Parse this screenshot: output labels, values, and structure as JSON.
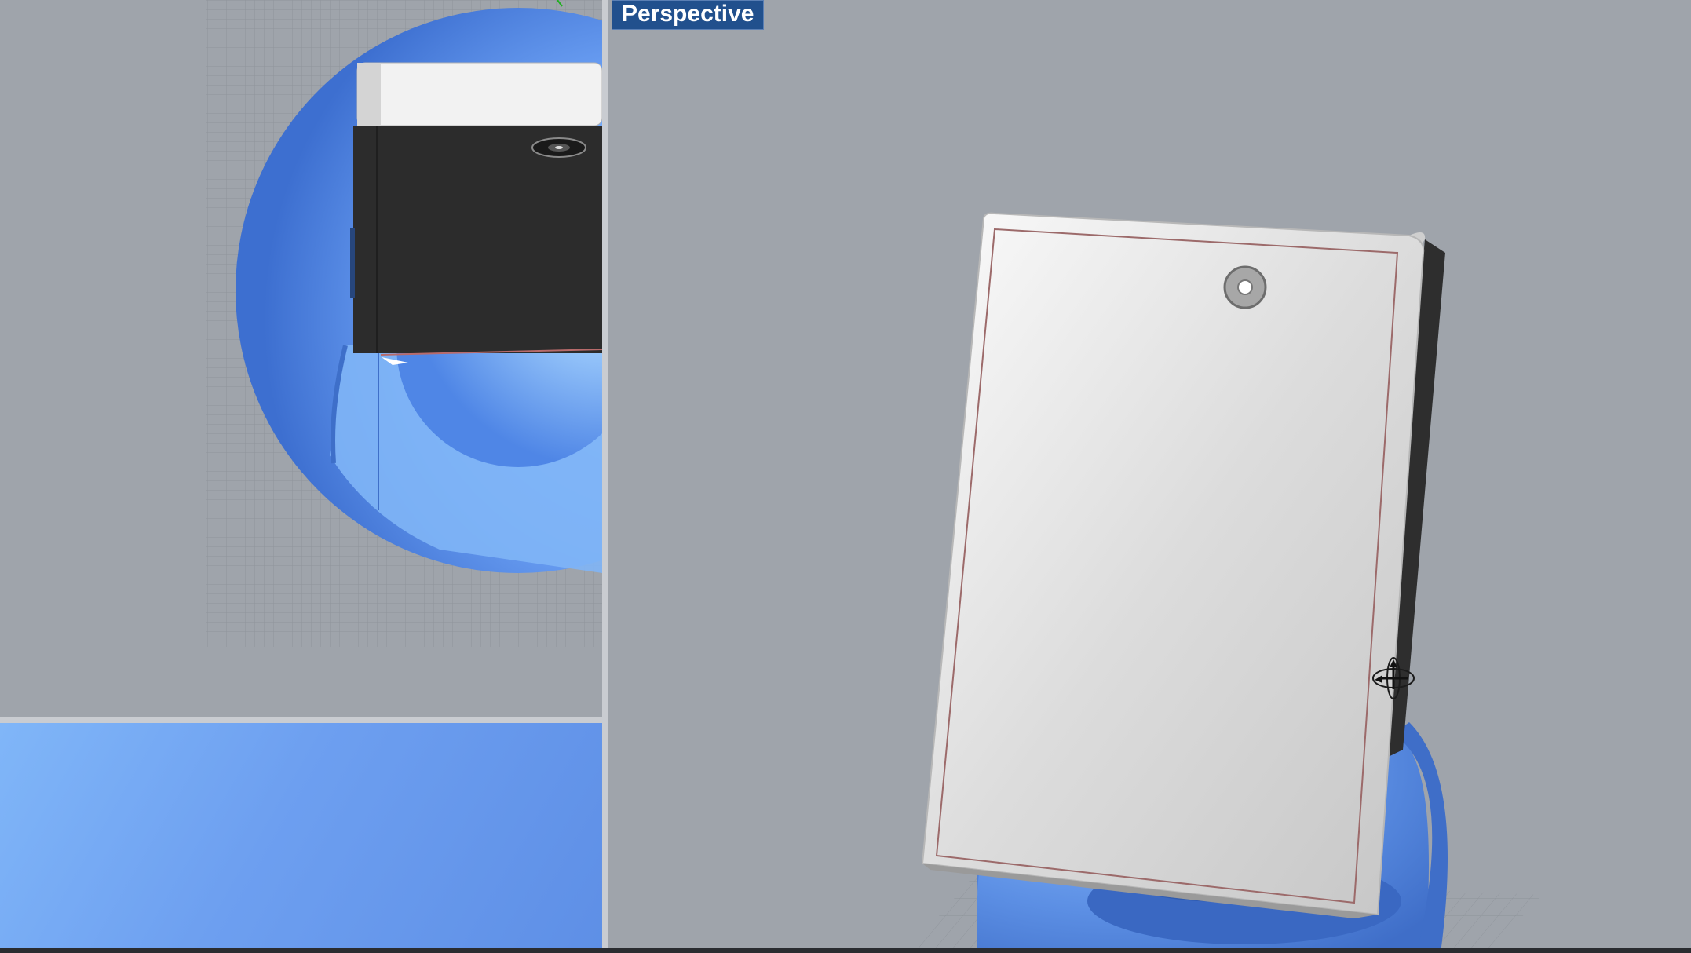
{
  "viewports": {
    "perspective": {
      "label": "Perspective",
      "label_bg": "#21508d",
      "label_color": "#ffffff"
    }
  },
  "colors": {
    "background": "#9fa4ab",
    "accent_blue": "#6fa3f5",
    "phone_body": "#e6e6e6",
    "phone_side": "#2b2b2b",
    "grid_line": "#8e939a"
  },
  "icons": {
    "gumball": "gumball-manipulator-icon",
    "camera": "camera-lens-icon"
  }
}
